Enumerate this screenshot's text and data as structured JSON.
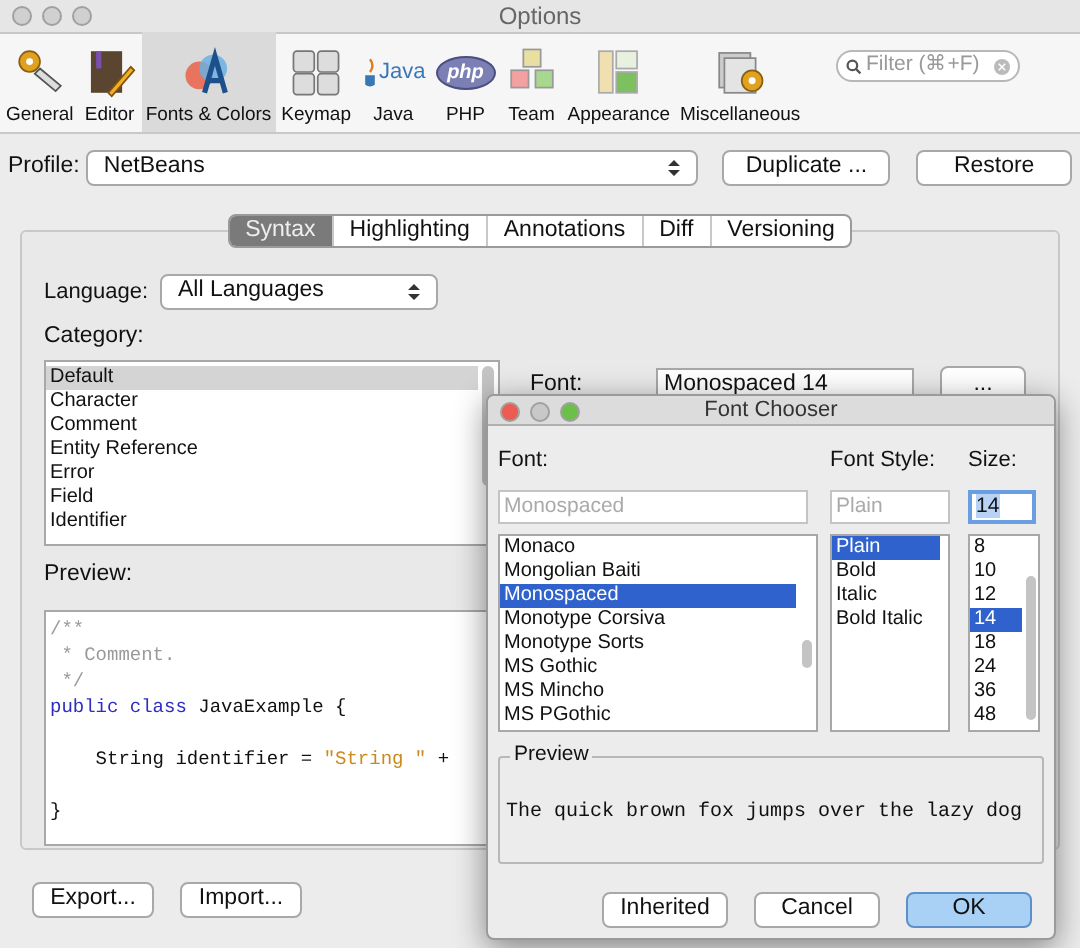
{
  "window": {
    "title": "Options"
  },
  "toolbar": [
    {
      "label": "General",
      "selected": false
    },
    {
      "label": "Editor",
      "selected": false
    },
    {
      "label": "Fonts & Colors",
      "selected": true
    },
    {
      "label": "Keymap",
      "selected": false
    },
    {
      "label": "Java",
      "selected": false,
      "logo_text": "Java"
    },
    {
      "label": "PHP",
      "selected": false,
      "logo_text": "php"
    },
    {
      "label": "Team",
      "selected": false
    },
    {
      "label": "Appearance",
      "selected": false
    },
    {
      "label": "Miscellaneous",
      "selected": false
    }
  ],
  "filter": {
    "placeholder": "Filter (⌘+F)"
  },
  "profile": {
    "label": "Profile:",
    "value": "NetBeans",
    "buttons": [
      "Duplicate ...",
      "Restore"
    ]
  },
  "tabs": [
    {
      "label": "Syntax",
      "selected": true
    },
    {
      "label": "Highlighting",
      "selected": false
    },
    {
      "label": "Annotations",
      "selected": false
    },
    {
      "label": "Diff",
      "selected": false
    },
    {
      "label": "Versioning",
      "selected": false
    }
  ],
  "language": {
    "label": "Language:",
    "value": "All Languages"
  },
  "category": {
    "label": "Category:",
    "items": [
      {
        "label": "Default",
        "selected": true
      },
      {
        "label": "Character",
        "selected": false
      },
      {
        "label": "Comment",
        "selected": false
      },
      {
        "label": "Entity Reference",
        "selected": false
      },
      {
        "label": "Error",
        "selected": false
      },
      {
        "label": "Field",
        "selected": false
      },
      {
        "label": "Identifier",
        "selected": false
      }
    ]
  },
  "font": {
    "label": "Font:",
    "value": "Monospaced 14",
    "button": "..."
  },
  "preview": {
    "label": "Preview:",
    "lines": [
      {
        "kind": "code",
        "tokens": [
          {
            "kind": "comment",
            "text": "/**"
          }
        ]
      },
      {
        "kind": "code",
        "tokens": [
          {
            "kind": "comment",
            "text": " * Comment."
          }
        ]
      },
      {
        "kind": "code",
        "tokens": [
          {
            "kind": "comment",
            "text": " */"
          }
        ]
      },
      {
        "kind": "code",
        "tokens": [
          {
            "kind": "keyword",
            "text": "public class"
          },
          {
            "kind": "plain",
            "text": " JavaExample {"
          }
        ]
      },
      {
        "kind": "blank"
      },
      {
        "kind": "code",
        "tokens": [
          {
            "kind": "plain",
            "text": "    String identifier = "
          },
          {
            "kind": "string",
            "text": "\"String \""
          },
          {
            "kind": "plain",
            "text": " +"
          }
        ]
      },
      {
        "kind": "blank"
      },
      {
        "kind": "code",
        "tokens": [
          {
            "kind": "plain",
            "text": "}"
          }
        ]
      }
    ]
  },
  "bottom_buttons": [
    "Export...",
    "Import..."
  ],
  "font_chooser": {
    "title": "Font Chooser",
    "font": {
      "label": "Font:",
      "placeholder": "Monospaced",
      "items": [
        {
          "label": "Monaco",
          "selected": false
        },
        {
          "label": "Mongolian Baiti",
          "selected": false
        },
        {
          "label": "Monospaced",
          "selected": true
        },
        {
          "label": "Monotype Corsiva",
          "selected": false
        },
        {
          "label": "Monotype Sorts",
          "selected": false
        },
        {
          "label": "MS Gothic",
          "selected": false
        },
        {
          "label": "MS Mincho",
          "selected": false
        },
        {
          "label": "MS PGothic",
          "selected": false
        }
      ]
    },
    "style": {
      "label": "Font Style:",
      "placeholder": "Plain",
      "items": [
        {
          "label": "Plain",
          "selected": true
        },
        {
          "label": "Bold",
          "selected": false
        },
        {
          "label": "Italic",
          "selected": false
        },
        {
          "label": "Bold Italic",
          "selected": false
        }
      ]
    },
    "size": {
      "label": "Size:",
      "value": "14",
      "items": [
        {
          "label": "8",
          "selected": false
        },
        {
          "label": "10",
          "selected": false
        },
        {
          "label": "12",
          "selected": false
        },
        {
          "label": "14",
          "selected": true
        },
        {
          "label": "18",
          "selected": false
        },
        {
          "label": "24",
          "selected": false
        },
        {
          "label": "36",
          "selected": false
        },
        {
          "label": "48",
          "selected": false
        }
      ]
    },
    "preview": {
      "label": "Preview",
      "text": "The quick brown fox jumps over the lazy dog"
    },
    "buttons": [
      {
        "label": "Inherited",
        "kind": "normal"
      },
      {
        "label": "Cancel",
        "kind": "normal"
      },
      {
        "label": "OK",
        "kind": "default"
      }
    ]
  }
}
